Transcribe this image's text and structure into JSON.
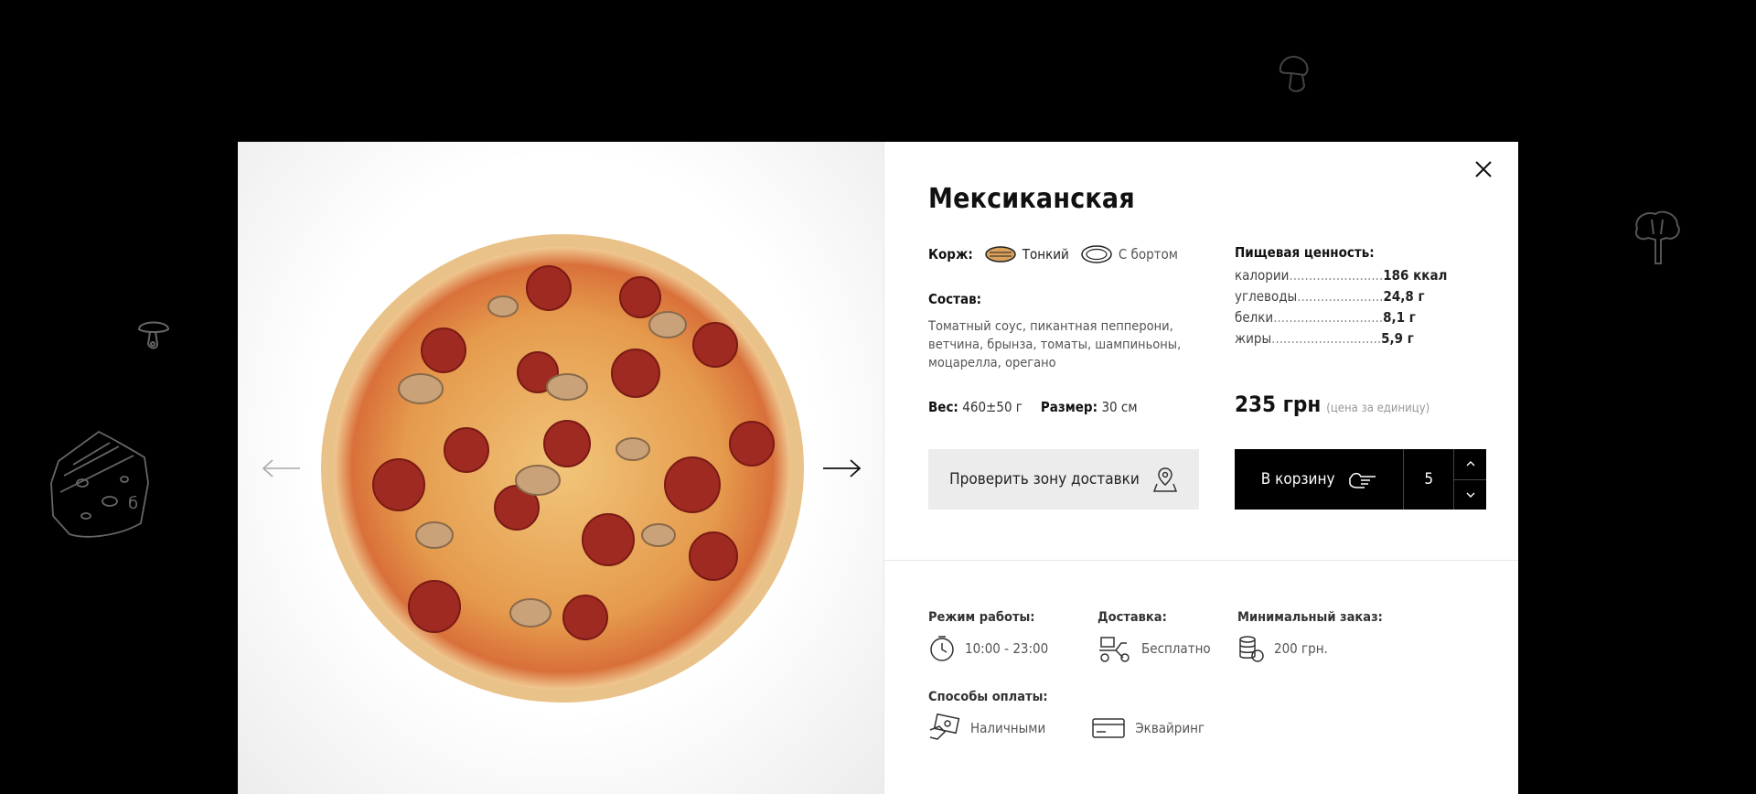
{
  "product": {
    "title": "Мексиканская",
    "crust_label": "Корж:",
    "crust_options": [
      {
        "label": "Тонкий",
        "active": true
      },
      {
        "label": "С бортом",
        "active": false
      }
    ],
    "composition_label": "Состав:",
    "composition_text": "Томатный соус, пикантная пепперони, ветчина, брынза, томаты, шампиньоны, моцарелла, орегано",
    "weight_label": "Вес:",
    "weight_value": "460±50 г",
    "size_label": "Размер:",
    "size_value": "30 см"
  },
  "nutrition": {
    "label": "Пищевая ценность:",
    "rows": [
      {
        "name": "калории",
        "dots": "........................",
        "value": "186 ккал"
      },
      {
        "name": "углеводы",
        "dots": "......................",
        "value": "24,8 г"
      },
      {
        "name": "белки",
        "dots": "............................",
        "value": "8,1 г"
      },
      {
        "name": "жиры",
        "dots": "............................",
        "value": "5,9 г"
      }
    ]
  },
  "price": {
    "amount": "235 грн",
    "note": "(цена за единицу)"
  },
  "actions": {
    "check_zone": "Проверить зону доставки",
    "add_to_cart": "В корзину",
    "quantity": "5"
  },
  "info": {
    "hours_label": "Режим работы:",
    "hours_value": "10:00 - 23:00",
    "delivery_label": "Доставка:",
    "delivery_value": "Бесплатно",
    "min_order_label": "Минимальный заказ:",
    "min_order_value": "200 грн.",
    "payment_label": "Способы оплаты:",
    "payment_cash": "Наличными",
    "payment_card": "Эквайринг"
  },
  "icons": [
    "close-icon",
    "arrow-left-icon",
    "arrow-right-icon",
    "thin-crust-icon",
    "crust-border-icon",
    "map-pin-icon",
    "pointing-hand-icon",
    "chevron-up-icon",
    "chevron-down-icon",
    "clock-icon",
    "scooter-icon",
    "coins-icon",
    "cash-icon",
    "card-icon",
    "mushroom-icon",
    "cheese-icon",
    "broccoli-icon"
  ],
  "colors": {
    "background": "#000000",
    "modal": "#ffffff",
    "cart_button": "#000000",
    "check_zone_button": "#ececec"
  }
}
